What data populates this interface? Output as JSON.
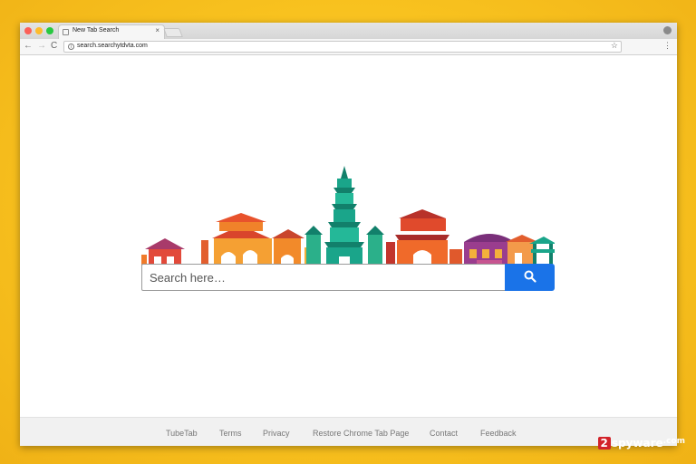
{
  "browser": {
    "tab_title": "New Tab Search",
    "tab_close": "×",
    "url": "search.searchytdvta.com",
    "back_icon": "←",
    "forward_icon": "→",
    "reload_icon": "C",
    "info_icon": "i",
    "star_icon": "☆",
    "menu_icon": "⋮"
  },
  "search": {
    "placeholder": "Search here…",
    "button_icon": "search-icon",
    "button_color": "#1a73e8"
  },
  "footer": {
    "links": [
      "TubeTab",
      "Terms",
      "Privacy",
      "Restore Chrome Tab Page",
      "Contact",
      "Feedback"
    ]
  },
  "watermark": {
    "number": "2",
    "name": "spyware",
    "domain": ".com"
  },
  "colors": {
    "background": "#f8c21f",
    "skyline_warm": "#f05a28",
    "skyline_teal": "#1aa58a",
    "skyline_purple": "#8e3b86"
  }
}
